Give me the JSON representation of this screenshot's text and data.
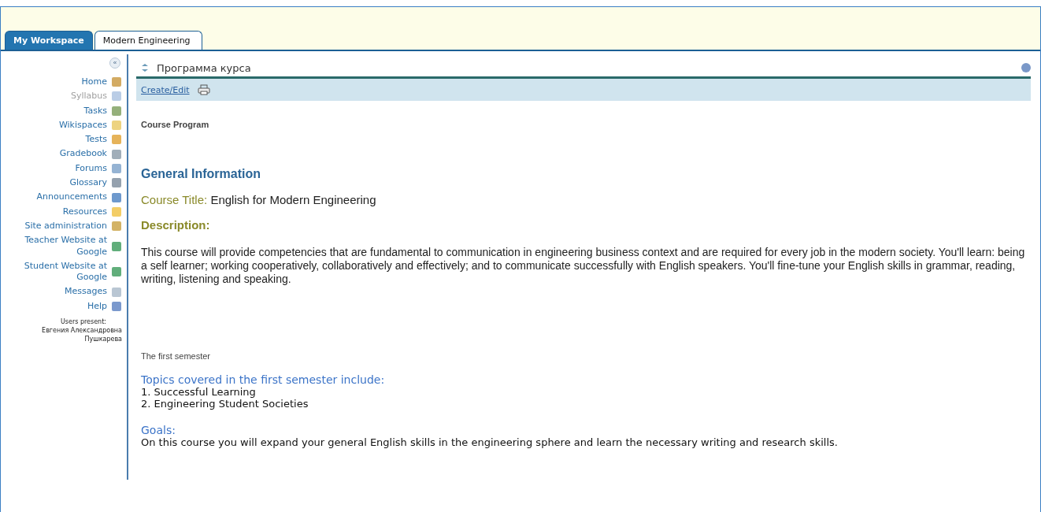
{
  "tabs": [
    {
      "label": "My Workspace",
      "selected": false
    },
    {
      "label": "Modern Engineering",
      "selected": true
    }
  ],
  "sidebar": {
    "collapse_button": "«",
    "items": [
      {
        "label": "Home",
        "selected": false
      },
      {
        "label": "Syllabus",
        "selected": true
      },
      {
        "label": "Tasks",
        "selected": false
      },
      {
        "label": "Wikispaces",
        "selected": false
      },
      {
        "label": "Tests",
        "selected": false
      },
      {
        "label": "Gradebook",
        "selected": false
      },
      {
        "label": "Forums",
        "selected": false
      },
      {
        "label": "Glossary",
        "selected": false
      },
      {
        "label": "Announcements",
        "selected": false
      },
      {
        "label": "Resources",
        "selected": false
      },
      {
        "label": "Site administration",
        "selected": false
      },
      {
        "label": "Teacher Website at Google",
        "selected": false
      },
      {
        "label": "Student Website at Google",
        "selected": false
      },
      {
        "label": "Messages",
        "selected": false
      },
      {
        "label": "Help",
        "selected": false
      }
    ],
    "users_present_label": "Users present:",
    "users": [
      "Евгения Александровна Пушкарева"
    ]
  },
  "tool": {
    "title": "Программа курса",
    "toolbar": {
      "link": "Create/Edit"
    }
  },
  "content": {
    "page_label": "Course Program",
    "heading": "General Information",
    "course_title_label": "Course Title:",
    "course_title": "English for Modern Engineering",
    "description_label": "Description:",
    "description": "This course will provide competencies that are fundamental to communication in engineering business context and are required for every job in the modern society. You'll learn: being a self learner; working cooperatively, collaboratively and effectively; and to communicate successfully with English speakers. You'll fine-tune your English skills in grammar, reading, writing, listening and speaking.",
    "semester_label": "The first semester",
    "topics_heading": "Topics covered in the first semester include:",
    "topics": [
      "1. Successful Learning",
      "2. Engineering Student Societies"
    ],
    "goals_heading": "Goals:",
    "goals": "On this course you will expand your general English skills in the engineering sphere and learn the necessary writing and research skills."
  }
}
